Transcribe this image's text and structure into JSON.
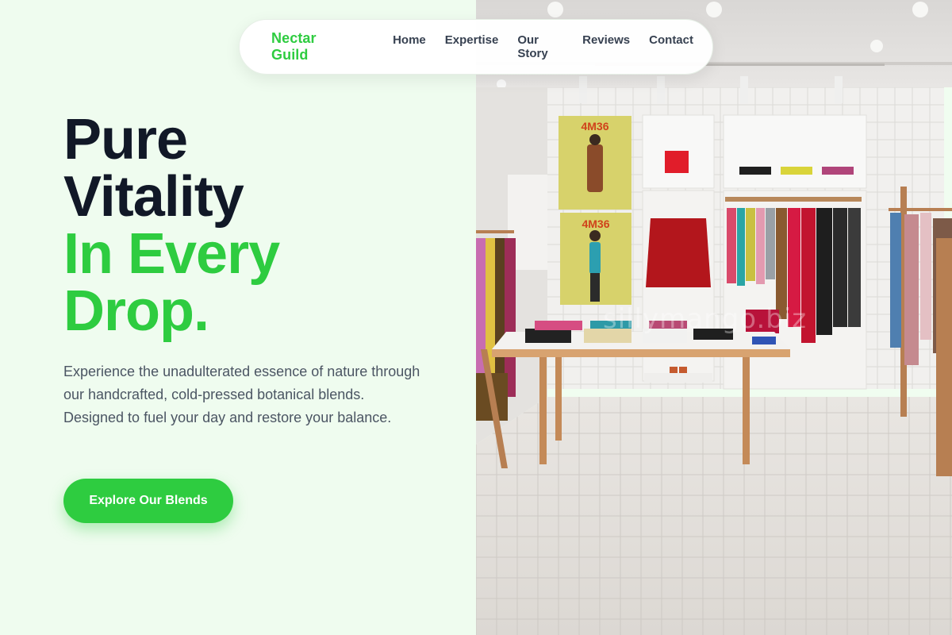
{
  "brand": {
    "name": "Nectar Guild"
  },
  "nav": {
    "items": [
      {
        "label": "Home"
      },
      {
        "label": "Expertise"
      },
      {
        "label": "Our Story"
      },
      {
        "label": "Reviews"
      },
      {
        "label": "Contact"
      }
    ]
  },
  "hero": {
    "headline_lines": [
      "Pure",
      "Vitality",
      "In Every",
      "Drop."
    ],
    "description": "Experience the unadulterated essence of nature through our handcrafted, cold-pressed botanical blends. Designed to fuel your day and restore your balance.",
    "cta_label": "Explore Our Blends"
  },
  "image": {
    "poster_text_1": "4M36",
    "poster_text_2": "4M36",
    "watermark": "sillymango.biz"
  },
  "colors": {
    "accent": "#2ecc40",
    "heading": "#111827",
    "body_text": "#4b5563",
    "background": "#effcef"
  }
}
